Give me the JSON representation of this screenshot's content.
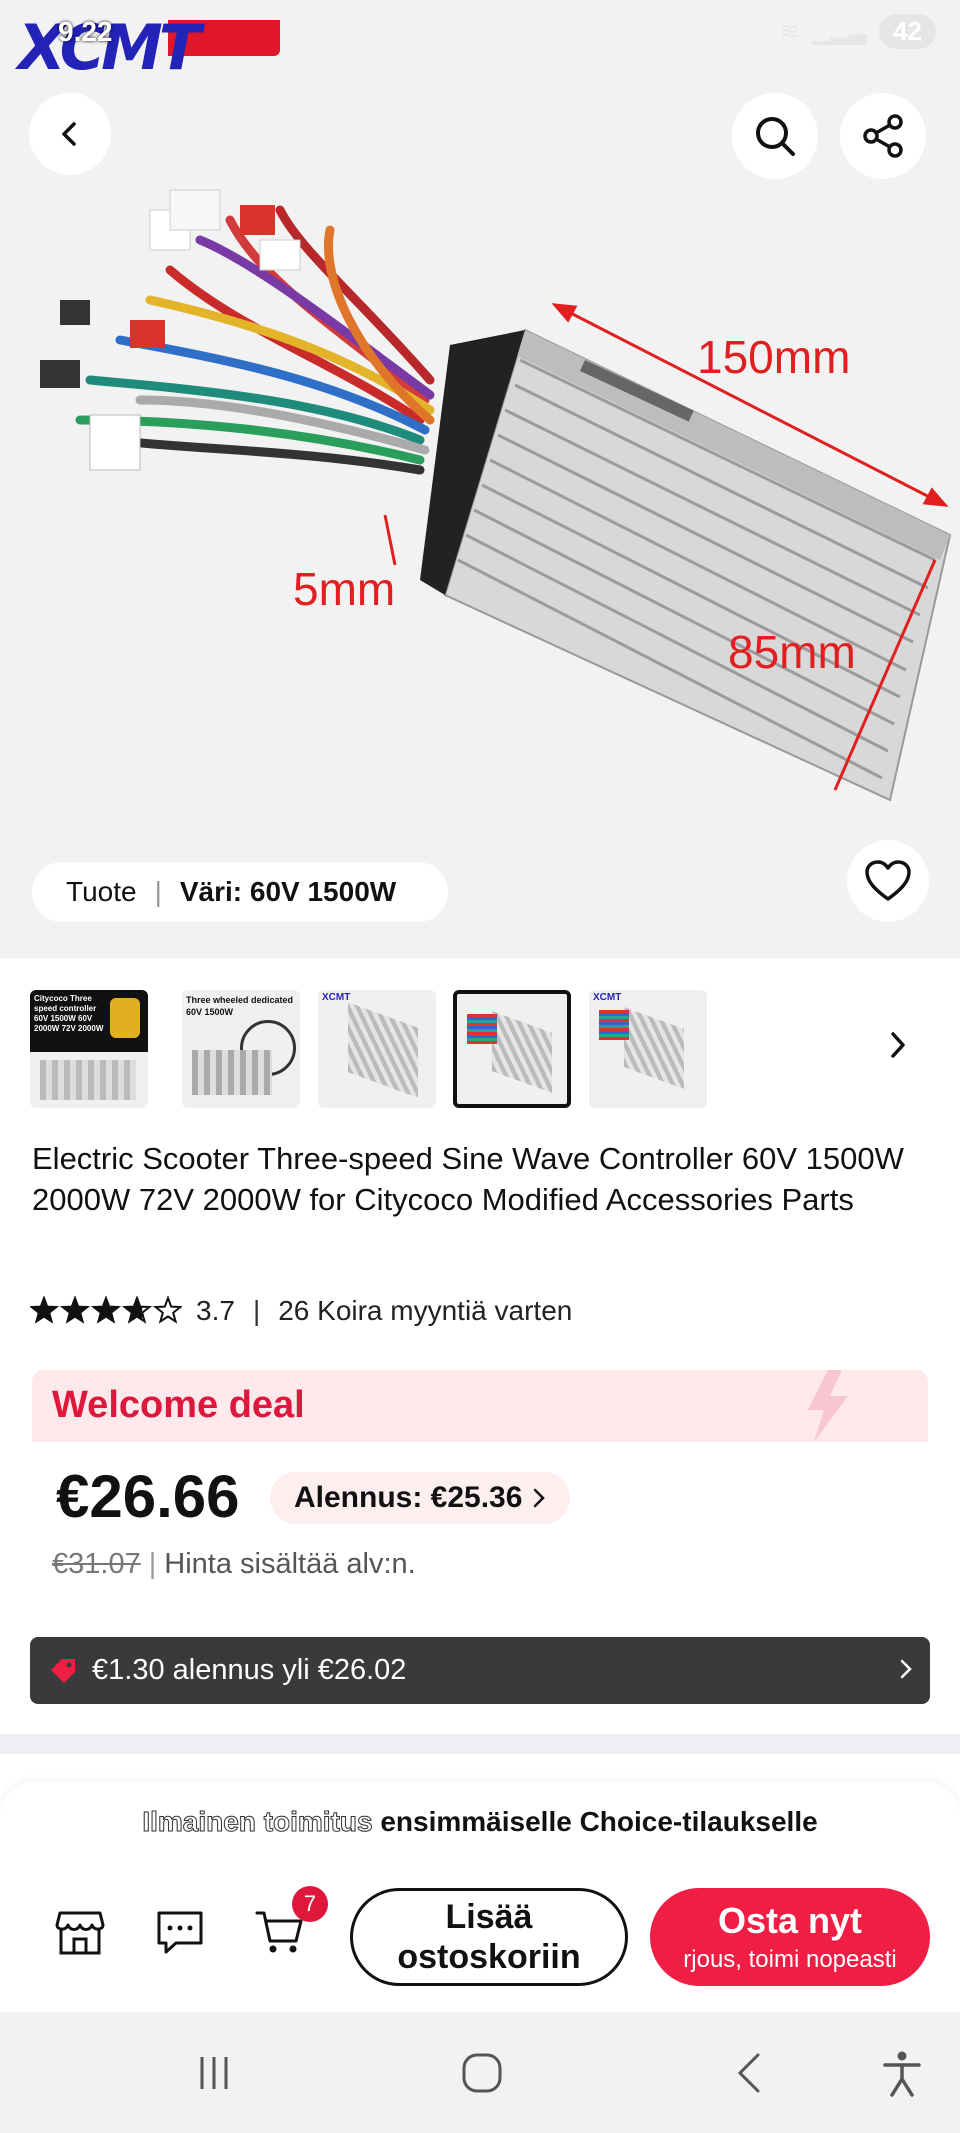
{
  "status": {
    "time": "9.22",
    "battery": "42",
    "logo_text": "XCMT"
  },
  "product_image": {
    "dim_length": "150mm",
    "dim_width": "85mm",
    "dim_height": "5mm"
  },
  "variant": {
    "label": "Tuote",
    "value": "Väri: 60V 1500W"
  },
  "thumbnails": [
    {
      "caption": "Citycoco Three speed controller 60V 1500W 60V 2000W 72V 2000W"
    },
    {
      "caption": "Three wheeled dedicated 60V 1500W"
    },
    {
      "caption": "XCMT"
    },
    {
      "caption": ""
    },
    {
      "caption": "XCMT"
    }
  ],
  "product": {
    "title": "Electric Scooter Three-speed Sine Wave Controller 60V 1500W 2000W 72V 2000W for Citycoco Modified Accessories Parts",
    "rating": "3.7",
    "rating_value": 3.7,
    "sold": "26 Koira myyntiä varten"
  },
  "deal": {
    "banner": "Welcome deal",
    "price": "€26.66",
    "discount": "Alennus: €25.36",
    "old_price": "€31.07",
    "vat_note": "Hinta sisältää alv:n."
  },
  "coupon": {
    "text": "€1.30 alennus yli €26.02"
  },
  "promo": {
    "highlight": "Ilmainen toimitus",
    "rest": " ensimmäiselle Choice-tilaukselle"
  },
  "actions": {
    "cart_count": "7",
    "add_to_cart": "Lisää ostoskoriin",
    "buy_now": "Osta nyt",
    "buy_sub": "rjous, toimi nopeasti"
  },
  "colors": {
    "accent_red": "#f01d45",
    "deal_bg": "#fde8ec",
    "coupon_bg": "#3a3a3a"
  }
}
